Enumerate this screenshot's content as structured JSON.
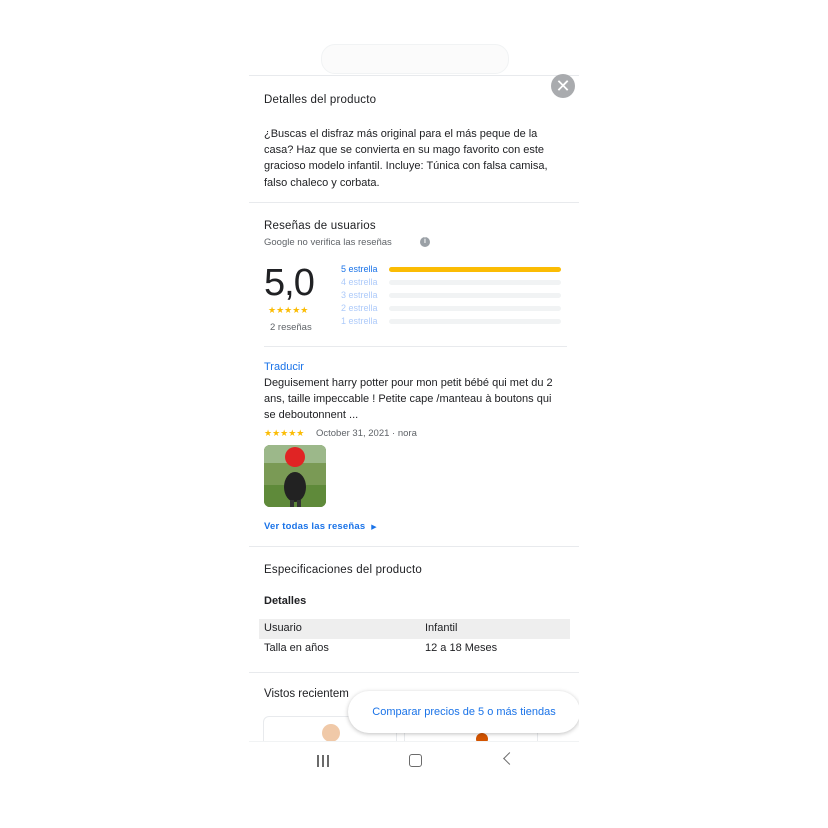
{
  "close_icon": "close-icon",
  "product_details": {
    "title": "Detalles del producto",
    "description": "¿Buscas el disfraz más original para el más peque de la casa? Haz que se convierta en su mago favorito con este gracioso modelo infantil. Incluye: Túnica con falsa camisa, falso chaleco y corbata."
  },
  "reviews": {
    "title": "Reseñas de usuarios",
    "disclaimer": "Google no verifica las reseñas",
    "average": "5,0",
    "stars": "★★★★★",
    "count_label": "2 reseñas",
    "distribution": [
      {
        "label": "5 estrella",
        "fraction": 1.0
      },
      {
        "label": "4 estrella",
        "fraction": 0.0
      },
      {
        "label": "3 estrella",
        "fraction": 0.0
      },
      {
        "label": "2 estrella",
        "fraction": 0.0
      },
      {
        "label": "1 estrella",
        "fraction": 0.0
      }
    ],
    "translate_label": "Traducir",
    "review": {
      "text": "Deguisement harry potter pour mon petit bébé qui met du 2 ans, taille impeccable ! Petite cape /manteau à boutons qui se deboutonnent ...",
      "stars": "★★★★★",
      "meta": "October 31, 2021 · nora"
    },
    "see_all": "Ver todas las reseñas"
  },
  "specs": {
    "title": "Especificaciones del producto",
    "heading": "Detalles",
    "rows": [
      {
        "key": "Usuario",
        "value": "Infantil"
      },
      {
        "key": "Talla en años",
        "value": "12 a 18 Meses"
      }
    ]
  },
  "recent": {
    "title": "Vistos recientem"
  },
  "compare_button": "Comparar precios de 5 o más tiendas",
  "colors": {
    "accent": "#1a73e8",
    "star": "#fbbc04",
    "text": "#202124",
    "secondary": "#5f6368"
  },
  "nav": {
    "recents_icon": "recents-icon",
    "home_icon": "home-icon",
    "back_icon": "back-icon"
  }
}
